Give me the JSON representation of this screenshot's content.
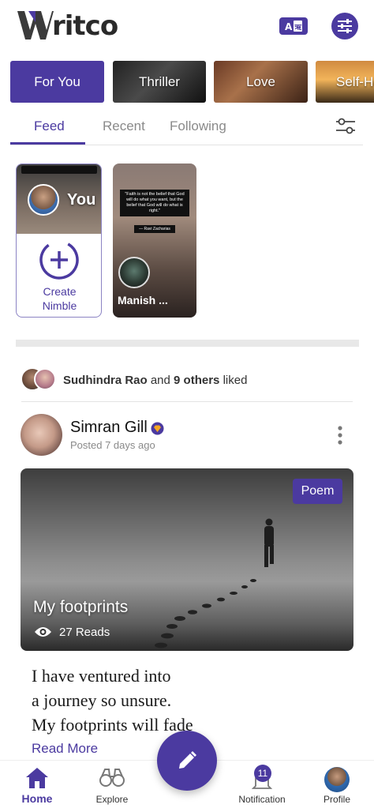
{
  "app": {
    "name": "Writco",
    "brand_color": "#4b3aa0"
  },
  "header": {
    "logo_text": "ritco",
    "translate_icon": "translate-icon",
    "filter_icon": "filter-sliders-icon"
  },
  "categories": [
    {
      "label": "For You",
      "active": true
    },
    {
      "label": "Thriller",
      "active": false
    },
    {
      "label": "Love",
      "active": false
    },
    {
      "label": "Self-He",
      "active": false
    }
  ],
  "tabs": [
    {
      "label": "Feed",
      "active": true
    },
    {
      "label": "Recent",
      "active": false
    },
    {
      "label": "Following",
      "active": false
    }
  ],
  "nimbles": {
    "you": {
      "label": "You",
      "create_line1": "Create",
      "create_line2": "Nimble"
    },
    "manish": {
      "name": "Manish ...",
      "quote": "\"Faith is not the belief that God will do what you want, but the belief that God will do what is right.\"",
      "quote_author": "— Ravi Zacharias"
    }
  },
  "liked": {
    "name": "Sudhindra Rao",
    "connector": "and",
    "others": "9 others",
    "suffix": "liked"
  },
  "post": {
    "author": "Simran Gill",
    "time": "Posted 7 days ago",
    "genre": "Poem",
    "title": "My footprints",
    "reads": "27 Reads",
    "excerpt": [
      "I have ventured into",
      "a journey so unsure.",
      "My footprints will fade"
    ],
    "read_more": "Read More"
  },
  "bottom_nav": {
    "home": "Home",
    "explore": "Explore",
    "notification": "Notification",
    "notification_count": "11",
    "profile": "Profile"
  }
}
